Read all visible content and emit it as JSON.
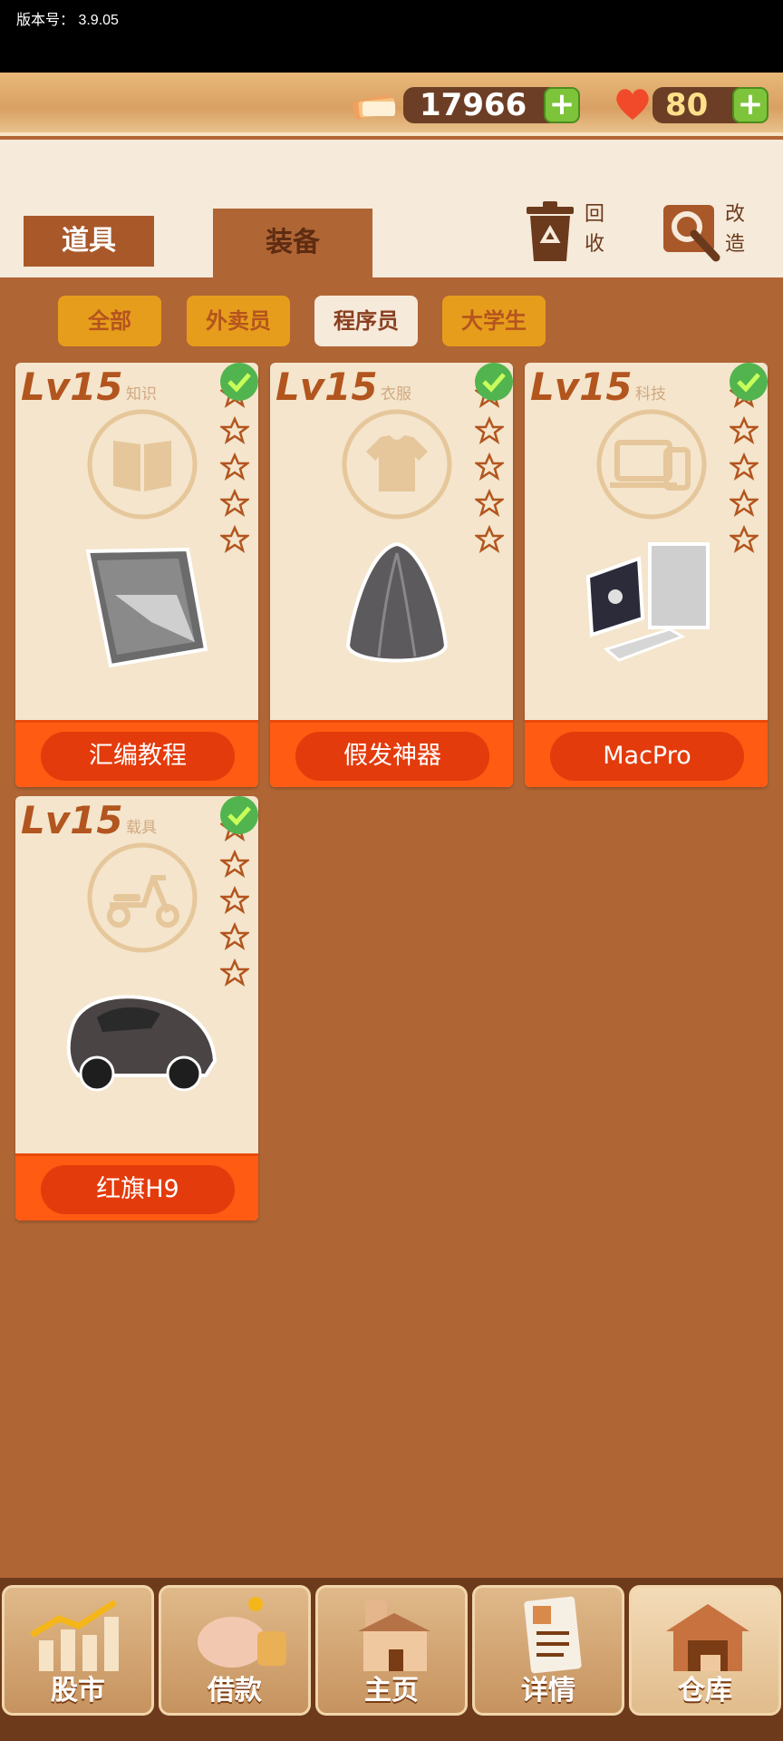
{
  "system": {
    "version_label": "版本号：  3.9.05"
  },
  "currency": {
    "money": "17966",
    "hearts": "80"
  },
  "tabs": {
    "props": "道具",
    "equipment": "装备"
  },
  "tools": {
    "recycle": {
      "line1": "回",
      "line2": "收"
    },
    "modify": {
      "line1": "改",
      "line2": "造"
    }
  },
  "filters": [
    "全部",
    "外卖员",
    "程序员",
    "大学生"
  ],
  "active_filter": "程序员",
  "cards": [
    {
      "level": "Lv15",
      "category": "知识",
      "name": "汇编教程",
      "icon": "book-icon",
      "item": "assembly-book-image"
    },
    {
      "level": "Lv15",
      "category": "衣服",
      "name": "假发神器",
      "icon": "shirt-icon",
      "item": "wig-image"
    },
    {
      "level": "Lv15",
      "category": "科技",
      "name": "MacPro",
      "icon": "devices-icon",
      "item": "mac-pro-image"
    },
    {
      "level": "Lv15",
      "category": "载具",
      "name": "红旗H9",
      "icon": "scooter-icon",
      "item": "car-image"
    }
  ],
  "bottom_nav": [
    {
      "label": "股市",
      "icon": "stock-chart-icon"
    },
    {
      "label": "借款",
      "icon": "piggy-bank-icon"
    },
    {
      "label": "主页",
      "icon": "house-icon"
    },
    {
      "label": "详情",
      "icon": "resume-icon"
    },
    {
      "label": "仓库",
      "icon": "warehouse-icon"
    }
  ],
  "active_nav": "仓库",
  "colors": {
    "background": "#b06535",
    "card": "#f4e5cc",
    "card_button": "#e43b0c",
    "chip": "#e69d1c",
    "check": "#52b44e"
  }
}
